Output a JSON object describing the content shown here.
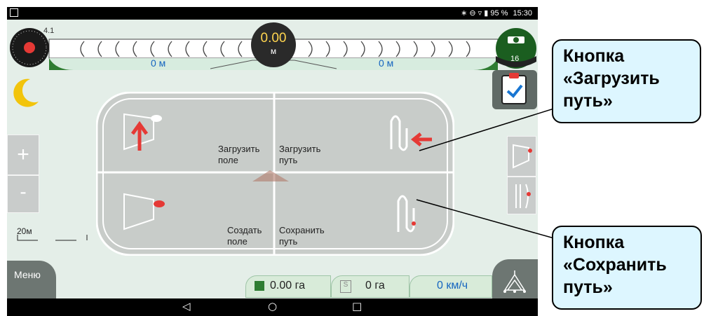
{
  "status_bar": {
    "battery": "95 %",
    "time": "15:30"
  },
  "top_bar": {
    "guidance_label": "4.1",
    "distance_left": "0 м",
    "distance_right": "0 м",
    "speed_value": "0.00",
    "speed_unit": "м",
    "gps_count": "16"
  },
  "left_controls": {
    "zoom_in": "+",
    "zoom_out": "-",
    "scale": "20м",
    "menu": "Меню"
  },
  "menu_panel": {
    "load_field": "Загрузить\nполе",
    "load_path": "Загрузить\nпуть",
    "create_field": "Создать\nполе",
    "save_path": "Сохранить\nпуть"
  },
  "bottom_bar": {
    "area_worked": "0.00 га",
    "area_s": "0 га",
    "speed": "0 км/ч"
  },
  "callouts": {
    "load_path": "Кнопка\n«Загрузить\nпуть»",
    "save_path": "Кнопка\n«Сохранить\nпуть»"
  },
  "colors": {
    "accent_red": "#e53935",
    "panel_bg": "#c8ccc9",
    "readout_blue": "#1565c0",
    "callout_bg": "#ddf6ff"
  }
}
